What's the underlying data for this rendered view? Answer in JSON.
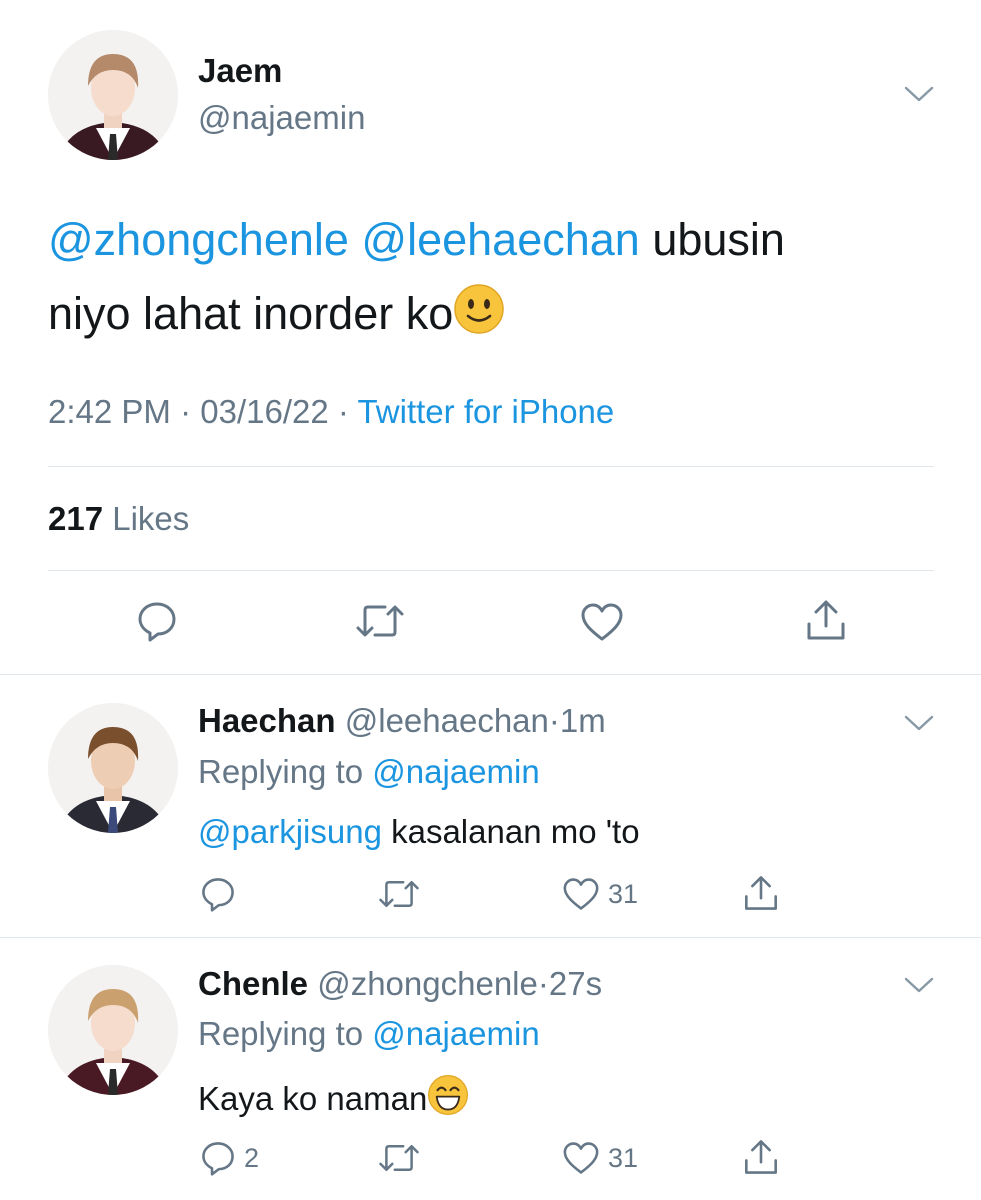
{
  "tweet": {
    "name": "Jaem",
    "handle": "@najaemin",
    "mention1": "@zhongchenle",
    "mention2": "@leehaechan",
    "text_line1": "ubusin",
    "text_line2": "niyo lahat inorder ko",
    "emoji_icon": "slightly-smiling-face-icon",
    "time": "2:42 PM",
    "sep1": "·",
    "date": "03/16/22",
    "sep2": "·",
    "source": "Twitter for iPhone",
    "likes_count": "217",
    "likes_label": "Likes",
    "actions": [
      "reply-icon",
      "retweet-icon",
      "like-icon",
      "share-icon"
    ]
  },
  "replies": [
    {
      "name": "Haechan",
      "handle": "@leehaechan",
      "sep": "·",
      "age": "1m",
      "replying_label": "Replying to",
      "replying_handle": "@najaemin",
      "mention": "@parkjisung",
      "text": "kasalanan mo 'to",
      "reply_count": "",
      "like_count": "31"
    },
    {
      "name": "Chenle",
      "handle": "@zhongchenle",
      "sep": "·",
      "age": "27s",
      "replying_label": "Replying to",
      "replying_handle": "@najaemin",
      "mention": "",
      "text": "Kaya ko naman",
      "emoji_icon": "grinning-face-icon",
      "reply_count": "2",
      "like_count": "31"
    }
  ],
  "colors": {
    "link": "#1b95e0",
    "secondary": "#657786",
    "text": "#14171a",
    "divider": "#e1e8ed"
  }
}
